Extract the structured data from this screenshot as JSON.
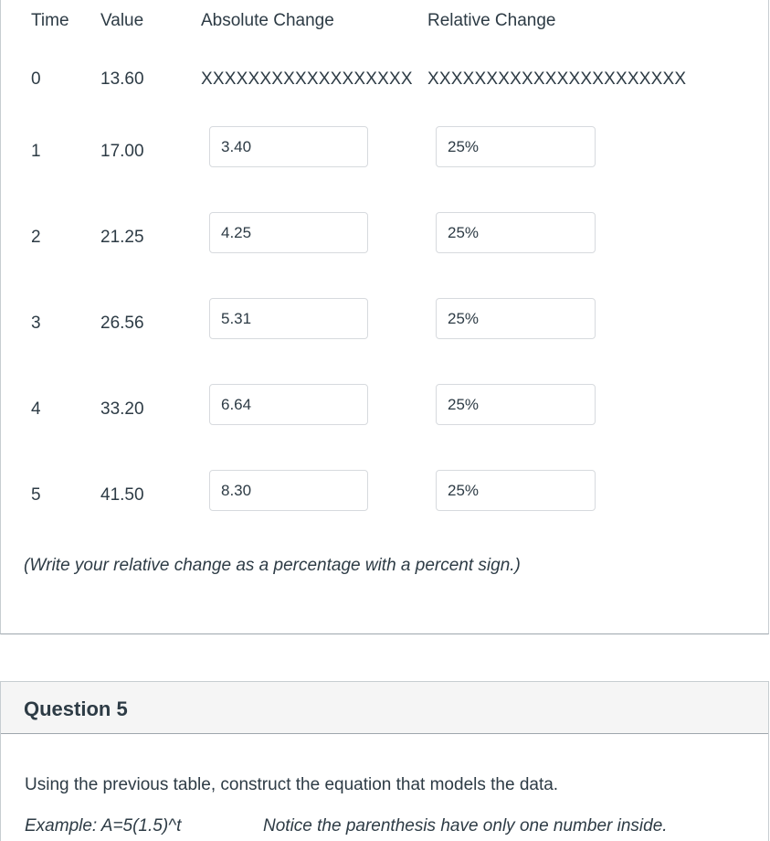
{
  "table": {
    "headers": {
      "time": "Time",
      "value": "Value",
      "absolute_change": "Absolute Change",
      "relative_change": "Relative Change"
    },
    "rows": [
      {
        "time": "0",
        "value": "13.60",
        "absolute_change_filler": "XXXXXXXXXXXXXXXXXX",
        "relative_change_filler": "XXXXXXXXXXXXXXXXXXXXXX",
        "has_inputs": false
      },
      {
        "time": "1",
        "value": "17.00",
        "absolute_change_input": "3.40",
        "relative_change_input": "25%",
        "has_inputs": true
      },
      {
        "time": "2",
        "value": "21.25",
        "absolute_change_input": "4.25",
        "relative_change_input": "25%",
        "has_inputs": true
      },
      {
        "time": "3",
        "value": "26.56",
        "absolute_change_input": "5.31",
        "relative_change_input": "25%",
        "has_inputs": true
      },
      {
        "time": "4",
        "value": "33.20",
        "absolute_change_input": "6.64",
        "relative_change_input": "25%",
        "has_inputs": true
      },
      {
        "time": "5",
        "value": "41.50",
        "absolute_change_input": "8.30",
        "relative_change_input": "25%",
        "has_inputs": true
      }
    ]
  },
  "note": "(Write your relative change as a percentage with a percent sign.)",
  "question5": {
    "title": "Question 5",
    "prompt": "Using the previous table, construct the equation that models the data.",
    "example": "Example:  A=5(1.5)^t",
    "hint": "Notice the parenthesis have only one number inside."
  }
}
